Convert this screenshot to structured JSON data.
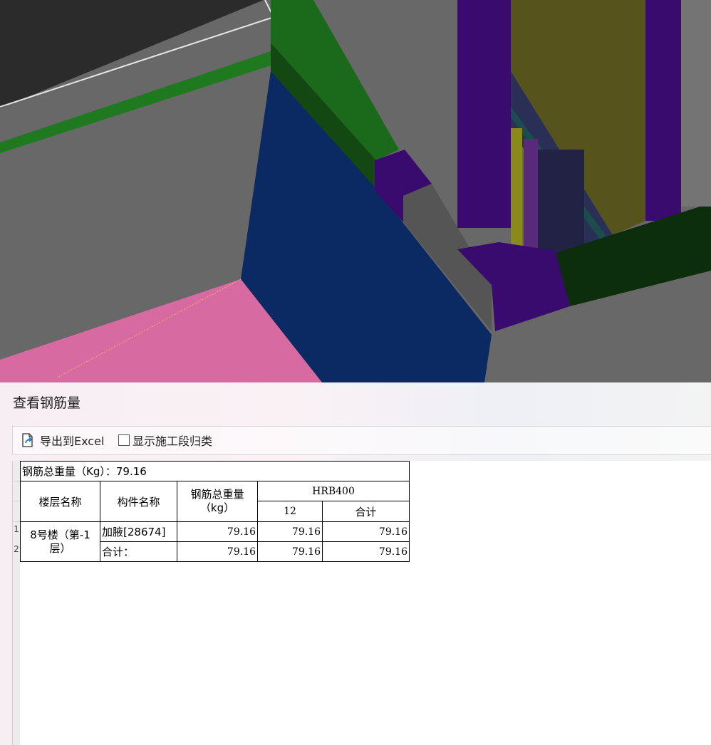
{
  "panel": {
    "title": "查看钢筋量",
    "export_label": "导出到Excel",
    "group_label": "显示施工段归类",
    "group_checked": false
  },
  "report": {
    "summary": "钢筋总重量（Kg）：79.16",
    "headers": {
      "floor": "楼层名称",
      "component": "构件名称",
      "total_weight": "钢筋总重量（kg）",
      "grade": "HRB400",
      "dia": "12",
      "subtotal": "合计"
    },
    "floor_name": "8号楼（第-1层）",
    "rows": [
      {
        "component": "加腋[28674]",
        "total": "79.16",
        "d12": "79.16",
        "sum": "79.16"
      },
      {
        "component": "合计：",
        "total": "79.16",
        "d12": "79.16",
        "sum": "79.16"
      }
    ],
    "row_numbers": [
      "1",
      "2"
    ]
  },
  "colors": {
    "wall_blue": "#0b2a63",
    "beam_green": "#1b5e1b",
    "column_purple": "#3a0b6e",
    "slab_pink": "#d86aa2",
    "panel_yellow": "#57531d"
  }
}
